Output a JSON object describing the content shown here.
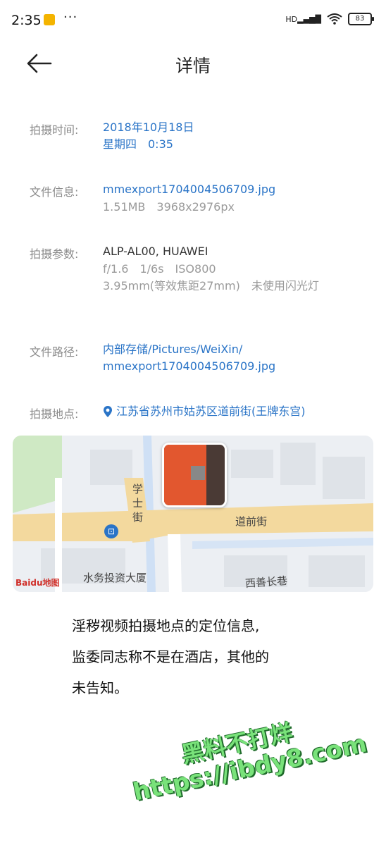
{
  "status_bar": {
    "time": "2:35",
    "more": "···",
    "battery": "83",
    "network": "HD"
  },
  "header": {
    "title": "详情"
  },
  "details": {
    "time": {
      "label": "拍摄时间:",
      "date": "2018年10月18日",
      "weekday_time": "星期四　0:35"
    },
    "file": {
      "label": "文件信息:",
      "name": "mmexport1704004506709.jpg",
      "meta": "1.51MB　3968x2976px"
    },
    "params": {
      "label": "拍摄参数:",
      "device": "ALP-AL00, HUAWEI",
      "exposure": "f/1.6　1/6s　ISO800",
      "lens": "3.95mm(等效焦距27mm)　未使用闪光灯"
    },
    "path": {
      "label": "文件路径:",
      "line1": "内部存储/Pictures/WeiXin/",
      "line2": "mmexport1704004506709.jpg"
    },
    "location": {
      "label": "拍摄地点:",
      "address": "江苏省苏州市姑苏区道前街(王牌东宫)"
    }
  },
  "map": {
    "streets": [
      "学士街",
      "道前街",
      "西善长巷",
      "水务投资大厦"
    ],
    "brand": "Baidu地图"
  },
  "note": {
    "line1": "淫秽视频拍摄地点的定位信息,",
    "line2": "监委同志称不是在酒店，其他的",
    "line3": "未告知。"
  },
  "watermark": {
    "line1": "黑料不打烊",
    "line2": "https://ibdy8.com"
  }
}
